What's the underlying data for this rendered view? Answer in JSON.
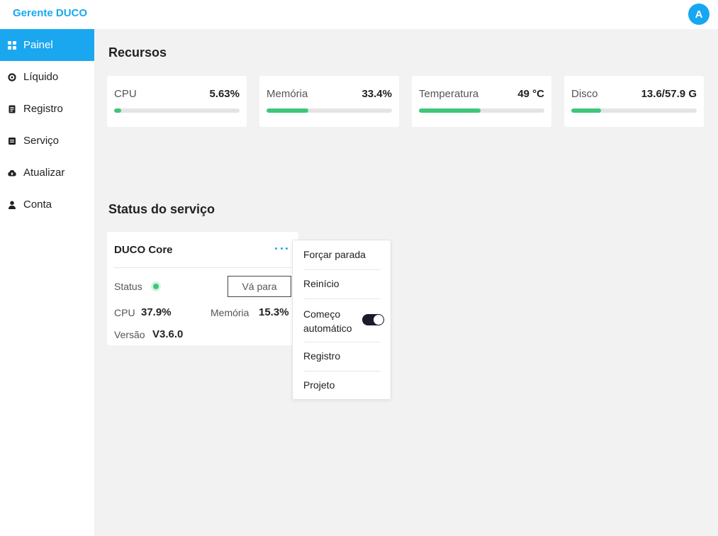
{
  "header": {
    "brand": "Gerente DUCO",
    "avatar_letter": "A"
  },
  "sidebar": {
    "items": [
      {
        "label": "Painel",
        "icon": "grid-icon",
        "active": true
      },
      {
        "label": "Líquido",
        "icon": "circle-dot-icon",
        "active": false
      },
      {
        "label": "Registro",
        "icon": "document-icon",
        "active": false
      },
      {
        "label": "Serviço",
        "icon": "service-box-icon",
        "active": false
      },
      {
        "label": "Atualizar",
        "icon": "cloud-upload-icon",
        "active": false
      },
      {
        "label": "Conta",
        "icon": "user-icon",
        "active": false
      }
    ]
  },
  "resources": {
    "title": "Recursos",
    "cards": [
      {
        "label": "CPU",
        "value": "5.63%",
        "fill": 0.0563
      },
      {
        "label": "Memória",
        "value": "33.4%",
        "fill": 0.334
      },
      {
        "label": "Temperatura",
        "value": "49 °C",
        "fill": 0.49
      },
      {
        "label": "Disco",
        "value": "13.6/57.9 G",
        "fill": 0.235
      }
    ]
  },
  "services": {
    "title": "Status do serviço",
    "card": {
      "name": "DUCO Core",
      "status_label": "Status",
      "status_color": "#3ec77a",
      "goto_label": "Vá para",
      "cpu_label": "CPU",
      "cpu_value": "37.9%",
      "memory_label": "Memória",
      "memory_value": "15.3%",
      "version_label": "Versão",
      "version_value": "V3.6.0"
    }
  },
  "menu": {
    "force_stop": "Forçar parada",
    "restart": "Reinício",
    "autostart": "Começo automático",
    "autostart_enabled": true,
    "log": "Registro",
    "project": "Projeto"
  },
  "colors": {
    "accent": "#1aa7f0",
    "progress": "#3ec77a",
    "toggle_on": "#1b1b2e"
  }
}
